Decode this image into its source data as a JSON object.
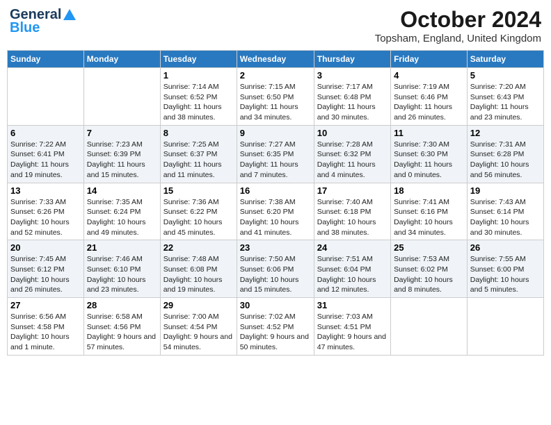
{
  "header": {
    "logo_general": "General",
    "logo_blue": "Blue",
    "month_title": "October 2024",
    "location": "Topsham, England, United Kingdom"
  },
  "weekdays": [
    "Sunday",
    "Monday",
    "Tuesday",
    "Wednesday",
    "Thursday",
    "Friday",
    "Saturday"
  ],
  "weeks": [
    [
      null,
      null,
      {
        "day": 1,
        "sunrise": "Sunrise: 7:14 AM",
        "sunset": "Sunset: 6:52 PM",
        "daylight": "Daylight: 11 hours and 38 minutes."
      },
      {
        "day": 2,
        "sunrise": "Sunrise: 7:15 AM",
        "sunset": "Sunset: 6:50 PM",
        "daylight": "Daylight: 11 hours and 34 minutes."
      },
      {
        "day": 3,
        "sunrise": "Sunrise: 7:17 AM",
        "sunset": "Sunset: 6:48 PM",
        "daylight": "Daylight: 11 hours and 30 minutes."
      },
      {
        "day": 4,
        "sunrise": "Sunrise: 7:19 AM",
        "sunset": "Sunset: 6:46 PM",
        "daylight": "Daylight: 11 hours and 26 minutes."
      },
      {
        "day": 5,
        "sunrise": "Sunrise: 7:20 AM",
        "sunset": "Sunset: 6:43 PM",
        "daylight": "Daylight: 11 hours and 23 minutes."
      }
    ],
    [
      {
        "day": 6,
        "sunrise": "Sunrise: 7:22 AM",
        "sunset": "Sunset: 6:41 PM",
        "daylight": "Daylight: 11 hours and 19 minutes."
      },
      {
        "day": 7,
        "sunrise": "Sunrise: 7:23 AM",
        "sunset": "Sunset: 6:39 PM",
        "daylight": "Daylight: 11 hours and 15 minutes."
      },
      {
        "day": 8,
        "sunrise": "Sunrise: 7:25 AM",
        "sunset": "Sunset: 6:37 PM",
        "daylight": "Daylight: 11 hours and 11 minutes."
      },
      {
        "day": 9,
        "sunrise": "Sunrise: 7:27 AM",
        "sunset": "Sunset: 6:35 PM",
        "daylight": "Daylight: 11 hours and 7 minutes."
      },
      {
        "day": 10,
        "sunrise": "Sunrise: 7:28 AM",
        "sunset": "Sunset: 6:32 PM",
        "daylight": "Daylight: 11 hours and 4 minutes."
      },
      {
        "day": 11,
        "sunrise": "Sunrise: 7:30 AM",
        "sunset": "Sunset: 6:30 PM",
        "daylight": "Daylight: 11 hours and 0 minutes."
      },
      {
        "day": 12,
        "sunrise": "Sunrise: 7:31 AM",
        "sunset": "Sunset: 6:28 PM",
        "daylight": "Daylight: 10 hours and 56 minutes."
      }
    ],
    [
      {
        "day": 13,
        "sunrise": "Sunrise: 7:33 AM",
        "sunset": "Sunset: 6:26 PM",
        "daylight": "Daylight: 10 hours and 52 minutes."
      },
      {
        "day": 14,
        "sunrise": "Sunrise: 7:35 AM",
        "sunset": "Sunset: 6:24 PM",
        "daylight": "Daylight: 10 hours and 49 minutes."
      },
      {
        "day": 15,
        "sunrise": "Sunrise: 7:36 AM",
        "sunset": "Sunset: 6:22 PM",
        "daylight": "Daylight: 10 hours and 45 minutes."
      },
      {
        "day": 16,
        "sunrise": "Sunrise: 7:38 AM",
        "sunset": "Sunset: 6:20 PM",
        "daylight": "Daylight: 10 hours and 41 minutes."
      },
      {
        "day": 17,
        "sunrise": "Sunrise: 7:40 AM",
        "sunset": "Sunset: 6:18 PM",
        "daylight": "Daylight: 10 hours and 38 minutes."
      },
      {
        "day": 18,
        "sunrise": "Sunrise: 7:41 AM",
        "sunset": "Sunset: 6:16 PM",
        "daylight": "Daylight: 10 hours and 34 minutes."
      },
      {
        "day": 19,
        "sunrise": "Sunrise: 7:43 AM",
        "sunset": "Sunset: 6:14 PM",
        "daylight": "Daylight: 10 hours and 30 minutes."
      }
    ],
    [
      {
        "day": 20,
        "sunrise": "Sunrise: 7:45 AM",
        "sunset": "Sunset: 6:12 PM",
        "daylight": "Daylight: 10 hours and 26 minutes."
      },
      {
        "day": 21,
        "sunrise": "Sunrise: 7:46 AM",
        "sunset": "Sunset: 6:10 PM",
        "daylight": "Daylight: 10 hours and 23 minutes."
      },
      {
        "day": 22,
        "sunrise": "Sunrise: 7:48 AM",
        "sunset": "Sunset: 6:08 PM",
        "daylight": "Daylight: 10 hours and 19 minutes."
      },
      {
        "day": 23,
        "sunrise": "Sunrise: 7:50 AM",
        "sunset": "Sunset: 6:06 PM",
        "daylight": "Daylight: 10 hours and 15 minutes."
      },
      {
        "day": 24,
        "sunrise": "Sunrise: 7:51 AM",
        "sunset": "Sunset: 6:04 PM",
        "daylight": "Daylight: 10 hours and 12 minutes."
      },
      {
        "day": 25,
        "sunrise": "Sunrise: 7:53 AM",
        "sunset": "Sunset: 6:02 PM",
        "daylight": "Daylight: 10 hours and 8 minutes."
      },
      {
        "day": 26,
        "sunrise": "Sunrise: 7:55 AM",
        "sunset": "Sunset: 6:00 PM",
        "daylight": "Daylight: 10 hours and 5 minutes."
      }
    ],
    [
      {
        "day": 27,
        "sunrise": "Sunrise: 6:56 AM",
        "sunset": "Sunset: 4:58 PM",
        "daylight": "Daylight: 10 hours and 1 minute."
      },
      {
        "day": 28,
        "sunrise": "Sunrise: 6:58 AM",
        "sunset": "Sunset: 4:56 PM",
        "daylight": "Daylight: 9 hours and 57 minutes."
      },
      {
        "day": 29,
        "sunrise": "Sunrise: 7:00 AM",
        "sunset": "Sunset: 4:54 PM",
        "daylight": "Daylight: 9 hours and 54 minutes."
      },
      {
        "day": 30,
        "sunrise": "Sunrise: 7:02 AM",
        "sunset": "Sunset: 4:52 PM",
        "daylight": "Daylight: 9 hours and 50 minutes."
      },
      {
        "day": 31,
        "sunrise": "Sunrise: 7:03 AM",
        "sunset": "Sunset: 4:51 PM",
        "daylight": "Daylight: 9 hours and 47 minutes."
      },
      null,
      null
    ]
  ]
}
